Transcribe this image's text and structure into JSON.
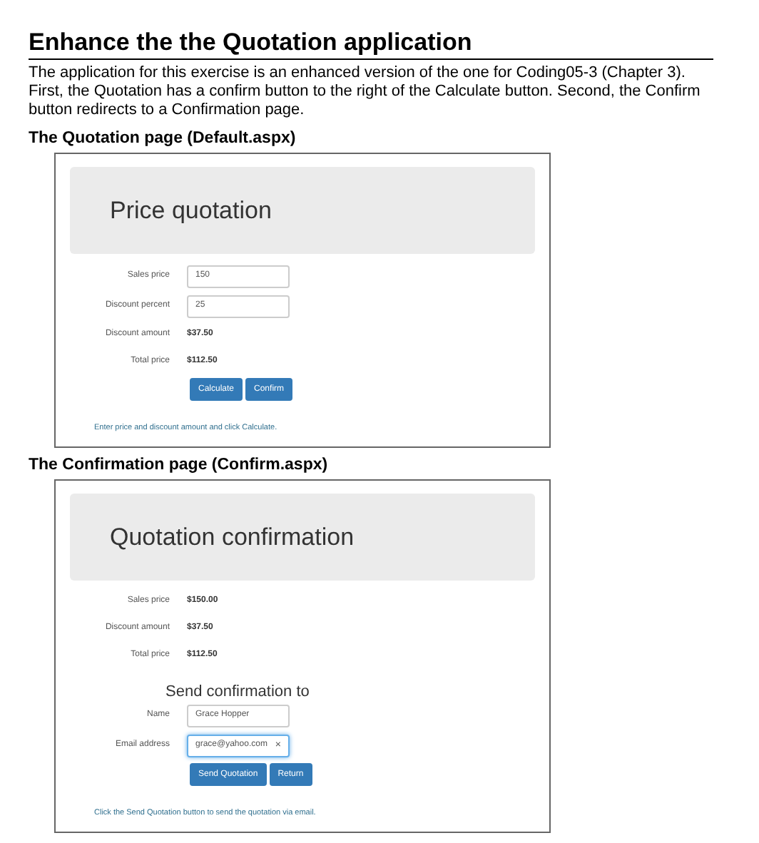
{
  "heading": "Enhance the the Quotation application",
  "intro": "The application for this exercise is an enhanced version of the one for Coding05-3 (Chapter 3). First, the Quotation has a confirm button to the right of the Calculate button. Second, the Confirm button redirects to a Confirmation page.",
  "sections": [
    {
      "title": "The Quotation page (Default.aspx)",
      "screen": {
        "banner": "Price quotation",
        "rows": [
          {
            "kind": "input",
            "label": "Sales price",
            "value": "150",
            "focused": false
          },
          {
            "kind": "input",
            "label": "Discount percent",
            "value": "25",
            "focused": false
          },
          {
            "kind": "output",
            "label": "Discount amount",
            "value": "$37.50"
          },
          {
            "kind": "output",
            "label": "Total price",
            "value": "$112.50"
          }
        ],
        "buttons": [
          "Calculate",
          "Confirm"
        ],
        "message": "Enter price and discount amount and click Calculate."
      }
    },
    {
      "title": "The Confirmation page (Confirm.aspx)",
      "screen": {
        "banner": "Quotation confirmation",
        "rows": [
          {
            "kind": "output",
            "label": "Sales price",
            "value": "$150.00"
          },
          {
            "kind": "output",
            "label": "Discount amount",
            "value": "$37.50"
          },
          {
            "kind": "output",
            "label": "Total price",
            "value": "$112.50"
          },
          {
            "kind": "subheading",
            "label": "Send confirmation to"
          },
          {
            "kind": "input",
            "label": "Name",
            "value": "Grace Hopper",
            "focused": false
          },
          {
            "kind": "input",
            "label": "Email address",
            "value": "grace@yahoo.com",
            "focused": true,
            "clear": "×"
          }
        ],
        "buttons": [
          "Send Quotation",
          "Return"
        ],
        "message": "Click the Send Quotation button to send the quotation via email."
      }
    }
  ]
}
